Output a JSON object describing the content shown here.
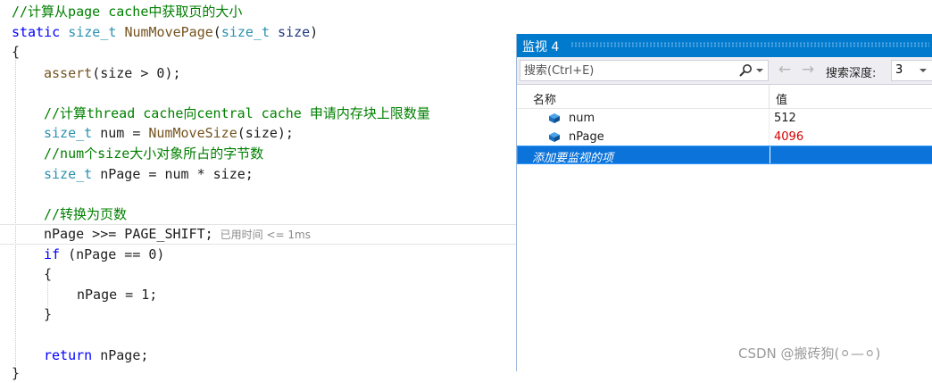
{
  "editor": {
    "line1_comment": "//计算从page cache中获取页的大小",
    "line2": {
      "kw": "static",
      "type": "size_t",
      "fn": "NumMovePage",
      "open": "(",
      "ptype": "size_t",
      "param": "size",
      "close": ")"
    },
    "line3": "{",
    "line4": {
      "fn": "assert",
      "arg": "(size > 0);"
    },
    "line6_comment": "//计算thread cache向central cache 申请内存块上限数量",
    "line7": {
      "type": "size_t",
      "rest1": " num = ",
      "fn": "NumMoveSize",
      "rest2": "(size);"
    },
    "line8_comment": "//num个size大小对象所占的字节数",
    "line9": {
      "type": "size_t",
      "rest": " nPage = num * size;"
    },
    "line11_comment": "//转换为页数",
    "line12": {
      "var": "nPage",
      "rest": " >>= PAGE_SHIFT;",
      "elapsed": "已用时间 <= 1ms"
    },
    "line13": {
      "kw": "if",
      "rest": " (nPage == 0)"
    },
    "line14": "{",
    "line15": "nPage = 1;",
    "line16": "}",
    "line18": {
      "kw": "return",
      "rest": " nPage;"
    },
    "line19": "}"
  },
  "watch": {
    "title": "监视 4",
    "search_placeholder": "搜索(Ctrl+E)",
    "depth_label": "搜索深度:",
    "depth_value": "3",
    "col_name": "名称",
    "col_value": "值",
    "rows": [
      {
        "name": "num",
        "value": "512",
        "value_color": "#1e1e1e"
      },
      {
        "name": "nPage",
        "value": "4096",
        "value_color": "#d40000"
      }
    ],
    "add_item": "添加要监视的项"
  },
  "icons": {
    "search": "magnifier-icon",
    "back": "arrow-left-icon",
    "forward": "arrow-right-icon",
    "variable": "variable-cube-icon"
  },
  "watermark": "CSDN @搬砖狗(⚪—⚪)",
  "colors": {
    "accent": "#007acc",
    "selection": "#0b73da",
    "changed_value": "#d40000"
  }
}
